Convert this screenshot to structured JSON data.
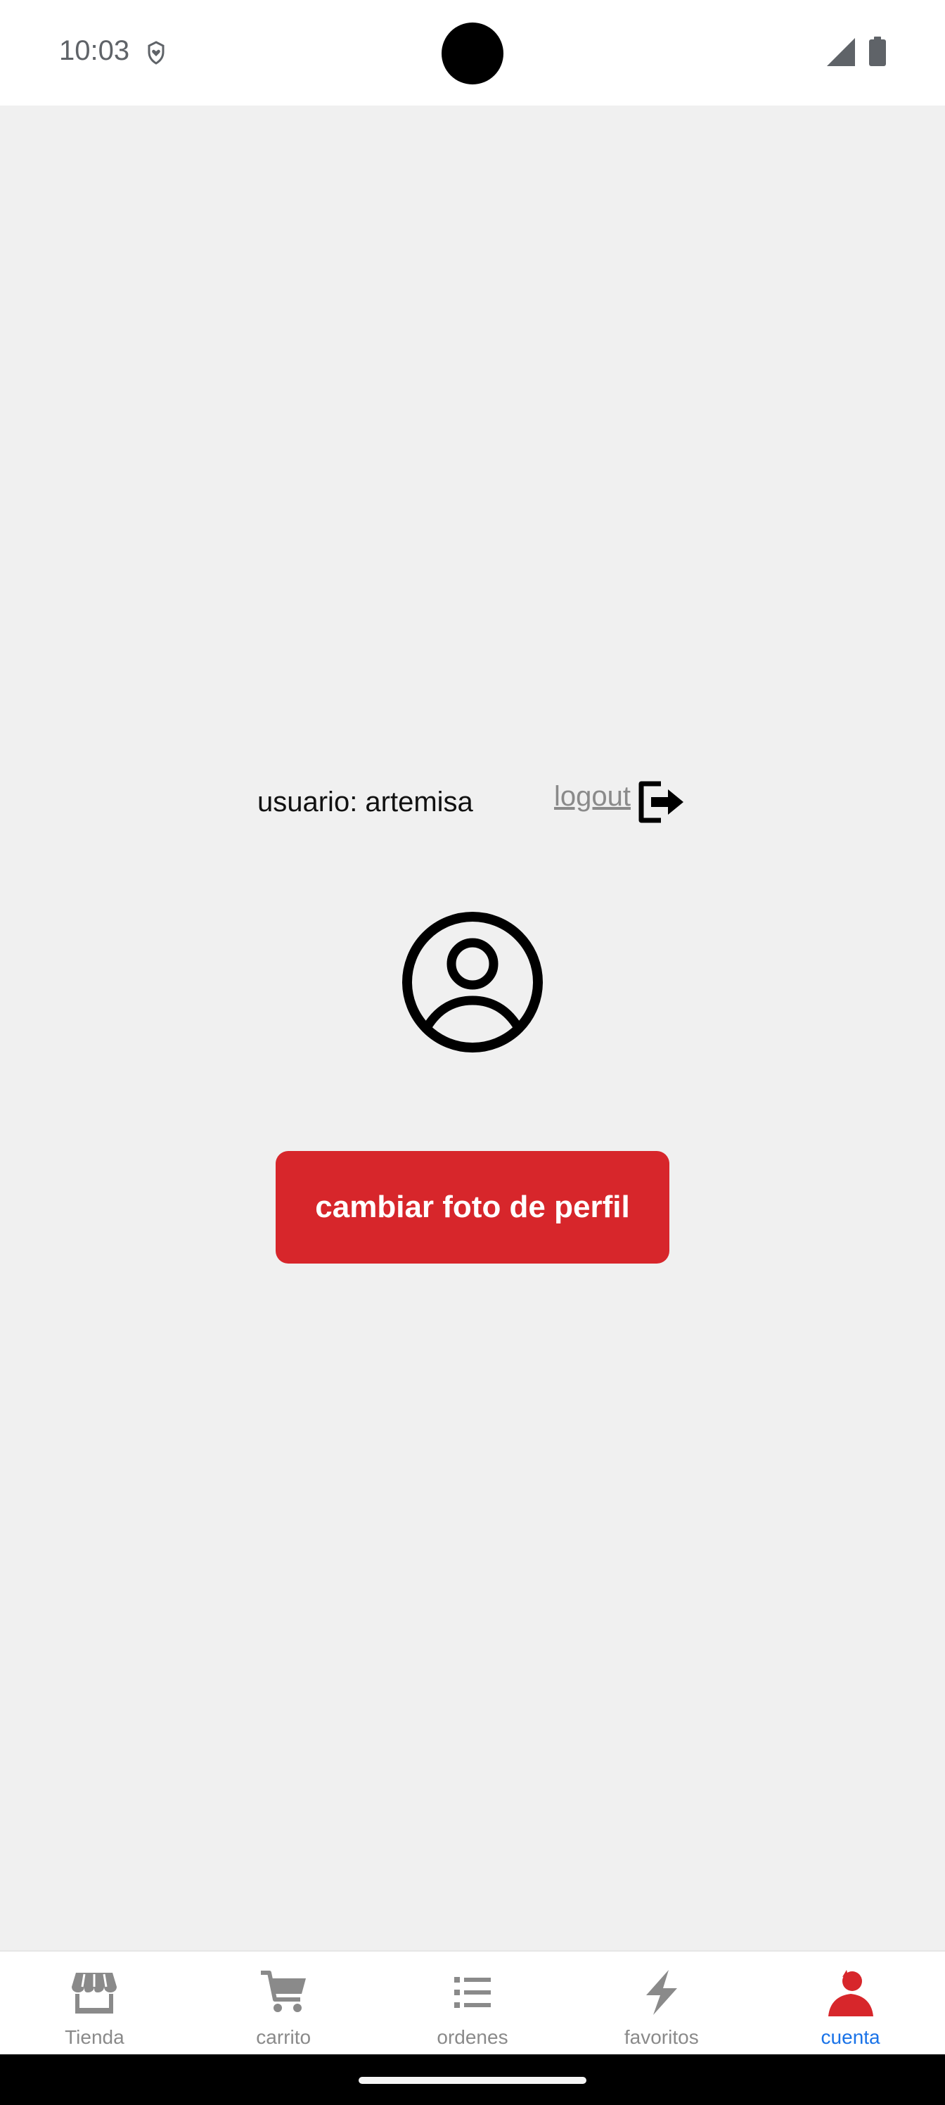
{
  "status_bar": {
    "time": "10:03",
    "notification_icon": "shield-heart-icon",
    "signal_icon": "cell-signal-icon",
    "battery_icon": "battery-icon"
  },
  "account": {
    "username_text": "usuario: artemisa",
    "logout_label": "logout",
    "logout_icon": "logout-icon",
    "avatar_icon": "account-circle-icon",
    "change_photo_label": "cambiar foto de perfil"
  },
  "bottom_nav": {
    "items": [
      {
        "label": "Tienda",
        "icon": "store-icon",
        "active": false
      },
      {
        "label": "carrito",
        "icon": "cart-icon",
        "active": false
      },
      {
        "label": "ordenes",
        "icon": "list-icon",
        "active": false
      },
      {
        "label": "favoritos",
        "icon": "bolt-icon",
        "active": false
      },
      {
        "label": "cuenta",
        "icon": "person-icon",
        "active": true
      }
    ]
  },
  "colors": {
    "accent_red": "#d7262b",
    "active_label_blue": "#1a73e8",
    "inactive_gray": "#8a8a8a",
    "background": "#f0f0f0"
  }
}
